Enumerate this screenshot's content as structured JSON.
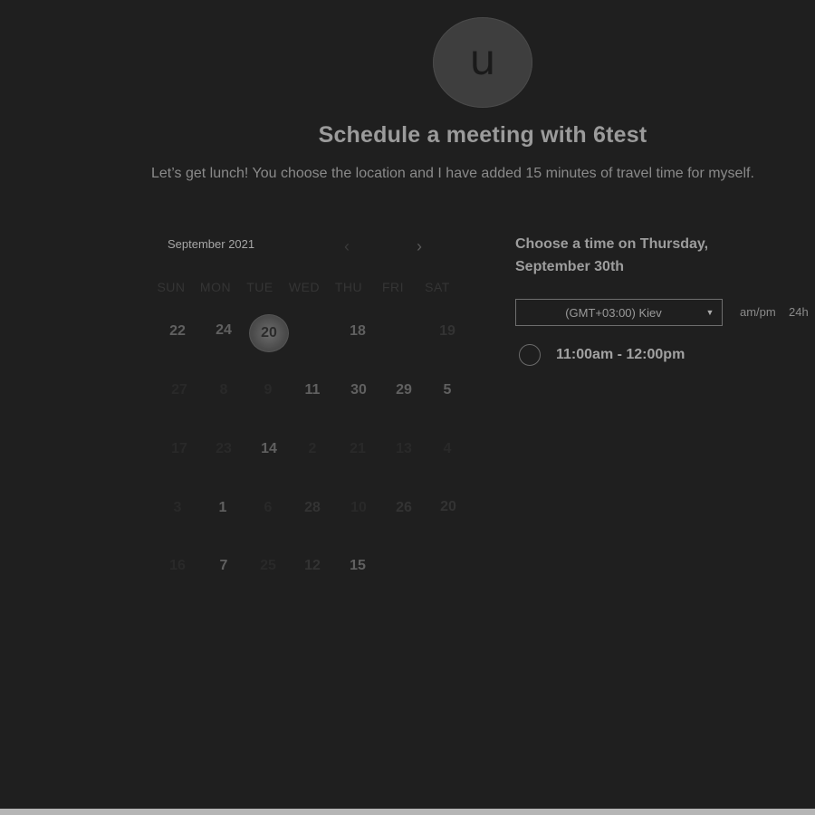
{
  "avatar": {
    "initial": "u"
  },
  "header": {
    "title": "Schedule a meeting with 6test",
    "description": "Let’s get lunch! You choose the location and I have added 15 minutes of travel time for myself."
  },
  "calendar": {
    "month_label": "September 2021",
    "prev_icon": "chevron-left-icon",
    "next_icon": "chevron-right-icon",
    "weekdays": [
      "SUN",
      "MON",
      "TUE",
      "WED",
      "THU",
      "FRI",
      "SAT"
    ],
    "weeks": [
      [
        "22",
        "24",
        "20",
        "",
        "18",
        "",
        "19"
      ],
      [
        "27",
        "8",
        "9",
        "11",
        "30",
        "29",
        "5"
      ],
      [
        "17",
        "23",
        "14",
        "2",
        "21",
        "13",
        "4"
      ],
      [
        "3",
        "1",
        "6",
        "28",
        "10",
        "26",
        "20"
      ],
      [
        "16",
        "7",
        "25",
        "12",
        "15",
        "",
        ""
      ]
    ],
    "selected_day": "20"
  },
  "time_picker": {
    "heading": "Choose a time on Thursday, September 30th",
    "timezone_value": "(GMT+03:00) Kiev",
    "format_ampm": "am/pm",
    "format_24h": "24h",
    "slots": [
      "11:00am - 12:00pm"
    ]
  }
}
